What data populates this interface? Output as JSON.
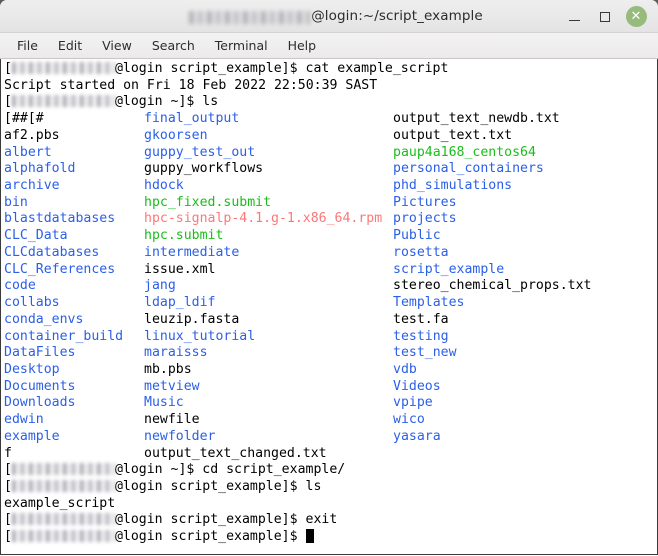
{
  "window": {
    "title_user_redacted": true,
    "title_suffix": "@login:~/script_example",
    "buttons": {
      "minimize_label": "—",
      "maximize_label": "□",
      "close_label": "✕"
    },
    "close_button_color": "#96bb7c",
    "titlebar_color": "#e9e8e8"
  },
  "menubar": {
    "items": [
      {
        "label": "File"
      },
      {
        "label": "Edit"
      },
      {
        "label": "View"
      },
      {
        "label": "Search"
      },
      {
        "label": "Terminal"
      },
      {
        "label": "Help"
      }
    ]
  },
  "terminal": {
    "colors": {
      "background": "#ffffff",
      "foreground": "#000000",
      "directory": "#2a5fe8",
      "executable": "#1bbd1b",
      "archive": "#fc7878"
    },
    "prompt_host": "@login",
    "prompt_cwd_script": "script_example]$",
    "prompt_cwd_home": "~]$",
    "lines": {
      "cmd_cat": "@login script_example]$ cat example_script",
      "script_started": "Script started on Fri 18 Feb 2022 22:50:39 SAST",
      "cmd_ls_home": "@login ~]$ ls",
      "cmd_cd": "@login ~]$ cd script_example/",
      "cmd_ls_dir": "@login script_example]$ ls",
      "ls_dir_output": "example_script",
      "cmd_exit": "@login script_example]$ exit",
      "prompt_final": "@login script_example]$ "
    },
    "ls_listing": [
      {
        "c1": "[##[#",
        "c1t": "plain",
        "c2": "final_output",
        "c2t": "dir",
        "c3": "output_text_newdb.txt",
        "c3t": "plain"
      },
      {
        "c1": "af2.pbs",
        "c1t": "plain",
        "c2": "gkoorsen",
        "c2t": "dir",
        "c3": "output_text.txt",
        "c3t": "plain"
      },
      {
        "c1": "albert",
        "c1t": "dir",
        "c2": "guppy_test_out",
        "c2t": "dir",
        "c3": "paup4a168_centos64",
        "c3t": "exec"
      },
      {
        "c1": "alphafold",
        "c1t": "dir",
        "c2": "guppy_workflows",
        "c2t": "plain",
        "c3": "personal_containers",
        "c3t": "dir"
      },
      {
        "c1": "archive",
        "c1t": "dir",
        "c2": "hdock",
        "c2t": "dir",
        "c3": "phd_simulations",
        "c3t": "dir"
      },
      {
        "c1": "bin",
        "c1t": "dir",
        "c2": "hpc_fixed.submit",
        "c2t": "exec",
        "c3": "Pictures",
        "c3t": "dir"
      },
      {
        "c1": "blastdatabases",
        "c1t": "dir",
        "c2": "hpc-signalp-4.1.g-1.x86_64.rpm",
        "c2t": "arch",
        "c3": "projects",
        "c3t": "dir"
      },
      {
        "c1": "CLC_Data",
        "c1t": "dir",
        "c2": "hpc.submit",
        "c2t": "exec",
        "c3": "Public",
        "c3t": "dir"
      },
      {
        "c1": "CLCdatabases",
        "c1t": "dir",
        "c2": "intermediate",
        "c2t": "dir",
        "c3": "rosetta",
        "c3t": "dir"
      },
      {
        "c1": "CLC_References",
        "c1t": "dir",
        "c2": "issue.xml",
        "c2t": "plain",
        "c3": "script_example",
        "c3t": "dir"
      },
      {
        "c1": "code",
        "c1t": "dir",
        "c2": "jang",
        "c2t": "dir",
        "c3": "stereo_chemical_props.txt",
        "c3t": "plain"
      },
      {
        "c1": "collabs",
        "c1t": "dir",
        "c2": "ldap_ldif",
        "c2t": "dir",
        "c3": "Templates",
        "c3t": "dir"
      },
      {
        "c1": "conda_envs",
        "c1t": "dir",
        "c2": "leuzip.fasta",
        "c2t": "plain",
        "c3": "test.fa",
        "c3t": "plain"
      },
      {
        "c1": "container_build",
        "c1t": "dir",
        "c2": "linux_tutorial",
        "c2t": "dir",
        "c3": "testing",
        "c3t": "dir"
      },
      {
        "c1": "DataFiles",
        "c1t": "dir",
        "c2": "maraisss",
        "c2t": "dir",
        "c3": "test_new",
        "c3t": "dir"
      },
      {
        "c1": "Desktop",
        "c1t": "dir",
        "c2": "mb.pbs",
        "c2t": "plain",
        "c3": "vdb",
        "c3t": "dir"
      },
      {
        "c1": "Documents",
        "c1t": "dir",
        "c2": "metview",
        "c2t": "dir",
        "c3": "Videos",
        "c3t": "dir"
      },
      {
        "c1": "Downloads",
        "c1t": "dir",
        "c2": "Music",
        "c2t": "dir",
        "c3": "vpipe",
        "c3t": "dir"
      },
      {
        "c1": "edwin",
        "c1t": "dir",
        "c2": "newfile",
        "c2t": "plain",
        "c3": "wico",
        "c3t": "dir"
      },
      {
        "c1": "example",
        "c1t": "dir",
        "c2": "newfolder",
        "c2t": "dir",
        "c3": "yasara",
        "c3t": "dir"
      },
      {
        "c1": "f",
        "c1t": "plain",
        "c2": "output_text_changed.txt",
        "c2t": "plain",
        "c3": "",
        "c3t": "plain"
      }
    ]
  }
}
